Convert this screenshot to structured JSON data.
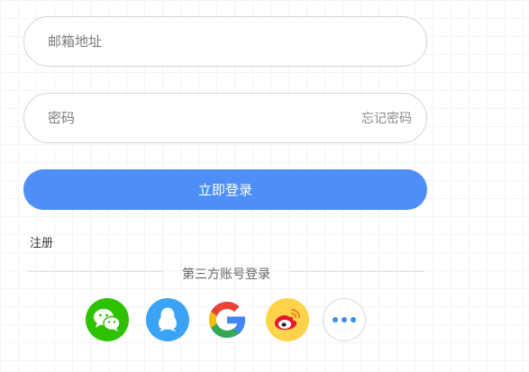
{
  "form": {
    "email_placeholder": "邮箱地址",
    "password_placeholder": "密码",
    "forgot_password": "忘记密码",
    "login_button": "立即登录",
    "register_link": "注册"
  },
  "third_party": {
    "divider_text": "第三方账号登录",
    "providers": [
      {
        "name": "wechat",
        "icon": "wechat-icon",
        "color": "#2dc100"
      },
      {
        "name": "qq",
        "icon": "qq-penguin-icon",
        "color": "#3ba3f6"
      },
      {
        "name": "google",
        "icon": "google-g-icon",
        "color": "#ffffff"
      },
      {
        "name": "weibo",
        "icon": "weibo-icon",
        "color": "#ffd44a"
      },
      {
        "name": "more",
        "icon": "more-dots-icon",
        "color": "#ffffff"
      }
    ]
  },
  "colors": {
    "primary": "#4e8ff7",
    "input_border": "#d4d4d4"
  }
}
